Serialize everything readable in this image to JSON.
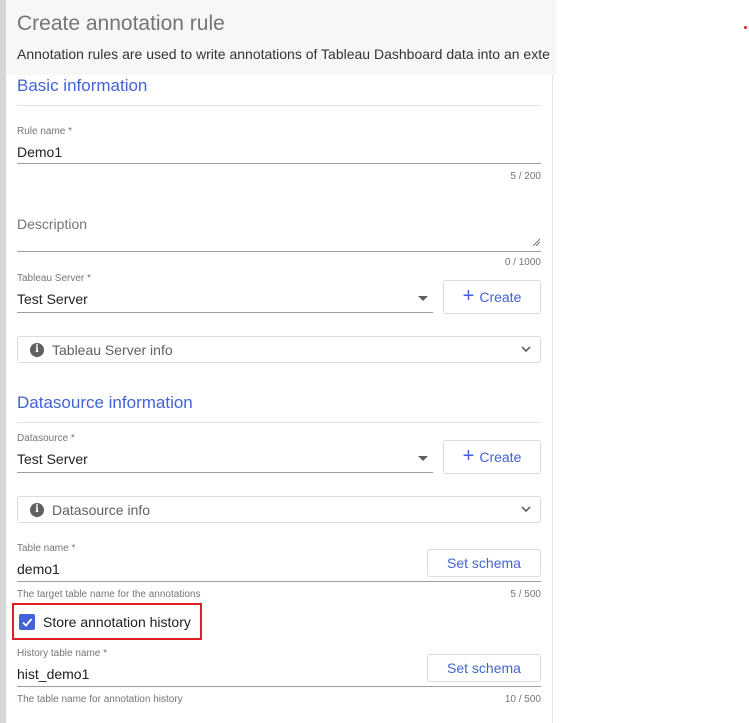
{
  "page": {
    "title": "Create annotation rule",
    "intro": "Annotation rules are used to write annotations of Tableau Dashboard data into an exte"
  },
  "basic": {
    "heading": "Basic information",
    "rule_name": {
      "label": "Rule name *",
      "value": "Demo1",
      "counter": "5 / 200"
    },
    "description": {
      "placeholder": "Description",
      "counter": "0 / 1000"
    },
    "tableau_server": {
      "label": "Tableau Server *",
      "value": "Test Server",
      "create_label": "Create"
    },
    "server_info": {
      "label": "Tableau Server info"
    }
  },
  "datasource": {
    "heading": "Datasource information",
    "datasource": {
      "label": "Datasource *",
      "value": "Test Server",
      "create_label": "Create"
    },
    "datasource_info": {
      "label": "Datasource info"
    },
    "table_name": {
      "label": "Table name *",
      "value": "demo1",
      "hint": "The target table name for the annotations",
      "counter": "5 / 500",
      "set_schema_label": "Set schema"
    },
    "store_history": {
      "label": "Store annotation history",
      "checked": true
    },
    "history_table": {
      "label": "History table name *",
      "value": "hist_demo1",
      "hint": "The table name for annotation history",
      "counter": "10 / 500",
      "set_schema_label": "Set schema"
    }
  },
  "colors": {
    "accent": "#4263d6",
    "highlight": "#e02020",
    "muted": "#757575"
  },
  "icons": [
    "plus-icon",
    "info-icon",
    "chevron-down-icon",
    "caret-down-icon",
    "check-icon",
    "resize-grip-icon"
  ]
}
